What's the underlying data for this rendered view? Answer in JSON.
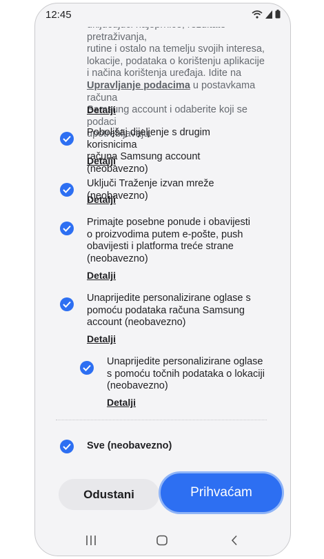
{
  "status": {
    "time": "12:45"
  },
  "top_text": {
    "lines": [
      "uključujući najeprnice, rezultate pretraživanja,",
      "rutine i ostalo na temelju svojih interesa,",
      "lokacije, podataka o korištenju aplikacije",
      "i načina korištenja uređaja. Idite na"
    ],
    "link": "Upravljanje podacima",
    "after_link": " u postavkama računa",
    "tail_lines": [
      "Samsung account i odaberite koji se podaci",
      "upotrebljavaju."
    ]
  },
  "details_label": "Detalji",
  "items": [
    {
      "lines": [
        "Poboljšaj dijeljenje s drugim korisnicima",
        "računa Samsung account (neobavezno)"
      ]
    },
    {
      "lines": [
        "Uključi Traženje izvan mreže (neobavezno)"
      ]
    },
    {
      "lines": [
        "Primajte posebne ponude i obavijesti",
        "o proizvodima putem e-pošte, push",
        "obavijesti i platforma treće strane",
        "(neobavezno)"
      ]
    },
    {
      "lines": [
        "Unaprijedite personalizirane oglase s",
        "pomoću podataka računa Samsung",
        "account (neobavezno)"
      ]
    },
    {
      "lines": [
        "Unaprijedite personalizirane oglase",
        "s pomoću točnih podataka o lokaciji",
        "(neobavezno)"
      ]
    }
  ],
  "all_label": "Sve (neobavezno)",
  "buttons": {
    "cancel": "Odustani",
    "accept": "Prihvaćam"
  },
  "colors": {
    "accent": "#2d6ff2",
    "check": "#2d6ff2"
  },
  "icons": [
    "wifi-icon",
    "signal-icon",
    "battery-icon",
    "check-icon",
    "recents-icon",
    "home-icon",
    "back-icon"
  ]
}
